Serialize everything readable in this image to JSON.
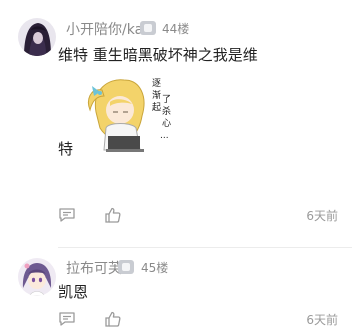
{
  "comments": [
    {
      "username": "小开陪你/ka",
      "level_badge": "L",
      "floor": "44楼",
      "text_line1": "维特 重生暗黑破坏神之我是维",
      "text_line2": "特",
      "sticker_text": "逐渐起了杀心...",
      "time": "6天前",
      "avatar_color": "#3a2a4a"
    },
    {
      "username": "拉布可芙",
      "level_badge": "L",
      "floor": "45楼",
      "text_line1": "凯恩",
      "time": "6天前",
      "avatar_color": "#6b5a8a"
    }
  ],
  "icons": [
    "reply-icon",
    "thumbs-up-icon",
    "level-badge-icon"
  ]
}
